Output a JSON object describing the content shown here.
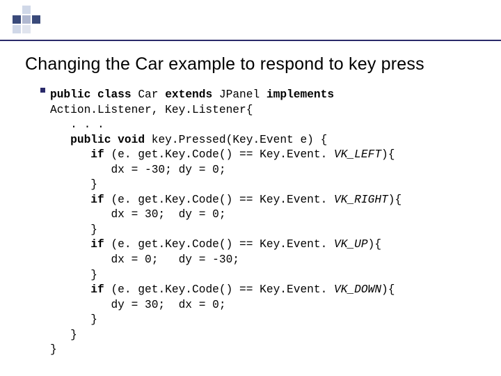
{
  "title": "Changing the Car example to respond to key press",
  "code": {
    "l1": {
      "a": "public",
      "b": "class",
      "c": "Car",
      "d": "extends",
      "e": "JPanel",
      "f": "implements"
    },
    "l2": "Action.Listener, Key.Listener{",
    "l3": ". . .",
    "l4": {
      "a": "public",
      "b": "void",
      "c": "key.Pressed(Key.Event e) {"
    },
    "l5": {
      "a": "if",
      "b": "(e. get.Key.Code() == Key.Event. ",
      "c": "VK_LEFT",
      "d": "){"
    },
    "l6": "dx = -30; dy = 0;",
    "l8": {
      "a": "if",
      "b": "(e. get.Key.Code() == Key.Event. ",
      "c": "VK_RIGHT",
      "d": "){"
    },
    "l9": "dx = 30;  dy = 0;",
    "l11": {
      "a": "if",
      "b": "(e. get.Key.Code() == Key.Event. ",
      "c": "VK_UP",
      "d": "){"
    },
    "l12": "dx = 0;   dy = -30;",
    "l14": {
      "a": "if",
      "b": "(e. get.Key.Code() == Key.Event. ",
      "c": "VK_DOWN",
      "d": "){"
    },
    "l15": "dy = 30;  dx = 0;",
    "brace": "}"
  }
}
